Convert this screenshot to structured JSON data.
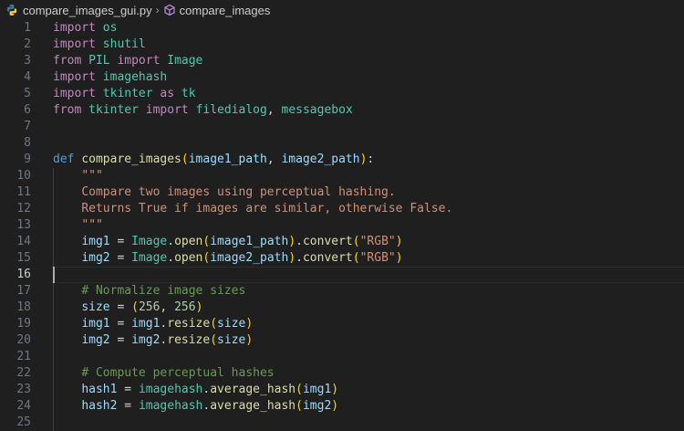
{
  "breadcrumb": {
    "file": "compare_images_gui.py",
    "symbol": "compare_images"
  },
  "current_line": 16,
  "lines": [
    {
      "n": "1",
      "tokens": [
        [
          "kw2",
          "import"
        ],
        [
          "plain",
          " "
        ],
        [
          "mod",
          "os"
        ]
      ]
    },
    {
      "n": "2",
      "tokens": [
        [
          "kw2",
          "import"
        ],
        [
          "plain",
          " "
        ],
        [
          "mod",
          "shutil"
        ]
      ]
    },
    {
      "n": "3",
      "tokens": [
        [
          "kw2",
          "from"
        ],
        [
          "plain",
          " "
        ],
        [
          "mod",
          "PIL"
        ],
        [
          "plain",
          " "
        ],
        [
          "kw2",
          "import"
        ],
        [
          "plain",
          " "
        ],
        [
          "mod",
          "Image"
        ]
      ]
    },
    {
      "n": "4",
      "tokens": [
        [
          "kw2",
          "import"
        ],
        [
          "plain",
          " "
        ],
        [
          "mod",
          "imagehash"
        ]
      ]
    },
    {
      "n": "5",
      "tokens": [
        [
          "kw2",
          "import"
        ],
        [
          "plain",
          " "
        ],
        [
          "mod",
          "tkinter"
        ],
        [
          "plain",
          " "
        ],
        [
          "kw2",
          "as"
        ],
        [
          "plain",
          " "
        ],
        [
          "mod",
          "tk"
        ]
      ]
    },
    {
      "n": "6",
      "tokens": [
        [
          "kw2",
          "from"
        ],
        [
          "plain",
          " "
        ],
        [
          "mod",
          "tkinter"
        ],
        [
          "plain",
          " "
        ],
        [
          "kw2",
          "import"
        ],
        [
          "plain",
          " "
        ],
        [
          "mod",
          "filedialog"
        ],
        [
          "plain",
          ", "
        ],
        [
          "mod",
          "messagebox"
        ]
      ]
    },
    {
      "n": "7",
      "tokens": []
    },
    {
      "n": "8",
      "tokens": []
    },
    {
      "n": "9",
      "tokens": [
        [
          "kw",
          "def"
        ],
        [
          "plain",
          " "
        ],
        [
          "fn",
          "compare_images"
        ],
        [
          "br1",
          "("
        ],
        [
          "var",
          "image1_path"
        ],
        [
          "plain",
          ", "
        ],
        [
          "var",
          "image2_path"
        ],
        [
          "br1",
          ")"
        ],
        [
          "plain",
          ":"
        ]
      ]
    },
    {
      "n": "10",
      "tokens": [
        [
          "plain",
          "    "
        ],
        [
          "str",
          "\"\"\""
        ]
      ]
    },
    {
      "n": "11",
      "tokens": [
        [
          "plain",
          "    "
        ],
        [
          "str",
          "Compare two images using perceptual hashing."
        ]
      ]
    },
    {
      "n": "12",
      "tokens": [
        [
          "plain",
          "    "
        ],
        [
          "str",
          "Returns True if images are similar, otherwise False."
        ]
      ]
    },
    {
      "n": "13",
      "tokens": [
        [
          "plain",
          "    "
        ],
        [
          "str",
          "\"\"\""
        ]
      ]
    },
    {
      "n": "14",
      "tokens": [
        [
          "plain",
          "    "
        ],
        [
          "var",
          "img1"
        ],
        [
          "plain",
          " = "
        ],
        [
          "mod",
          "Image"
        ],
        [
          "plain",
          "."
        ],
        [
          "fn",
          "open"
        ],
        [
          "br1",
          "("
        ],
        [
          "var",
          "image1_path"
        ],
        [
          "br1",
          ")"
        ],
        [
          "plain",
          "."
        ],
        [
          "fn",
          "convert"
        ],
        [
          "br1",
          "("
        ],
        [
          "str",
          "\"RGB\""
        ],
        [
          "br1",
          ")"
        ]
      ]
    },
    {
      "n": "15",
      "tokens": [
        [
          "plain",
          "    "
        ],
        [
          "var",
          "img2"
        ],
        [
          "plain",
          " = "
        ],
        [
          "mod",
          "Image"
        ],
        [
          "plain",
          "."
        ],
        [
          "fn",
          "open"
        ],
        [
          "br1",
          "("
        ],
        [
          "var",
          "image2_path"
        ],
        [
          "br1",
          ")"
        ],
        [
          "plain",
          "."
        ],
        [
          "fn",
          "convert"
        ],
        [
          "br1",
          "("
        ],
        [
          "str",
          "\"RGB\""
        ],
        [
          "br1",
          ")"
        ]
      ]
    },
    {
      "n": "16",
      "tokens": []
    },
    {
      "n": "17",
      "tokens": [
        [
          "plain",
          "    "
        ],
        [
          "com",
          "# Normalize image sizes"
        ]
      ]
    },
    {
      "n": "18",
      "tokens": [
        [
          "plain",
          "    "
        ],
        [
          "var",
          "size"
        ],
        [
          "plain",
          " = "
        ],
        [
          "br1",
          "("
        ],
        [
          "num",
          "256"
        ],
        [
          "plain",
          ", "
        ],
        [
          "num",
          "256"
        ],
        [
          "br1",
          ")"
        ]
      ]
    },
    {
      "n": "19",
      "tokens": [
        [
          "plain",
          "    "
        ],
        [
          "var",
          "img1"
        ],
        [
          "plain",
          " = "
        ],
        [
          "var",
          "img1"
        ],
        [
          "plain",
          "."
        ],
        [
          "fn",
          "resize"
        ],
        [
          "br1",
          "("
        ],
        [
          "var",
          "size"
        ],
        [
          "br1",
          ")"
        ]
      ]
    },
    {
      "n": "20",
      "tokens": [
        [
          "plain",
          "    "
        ],
        [
          "var",
          "img2"
        ],
        [
          "plain",
          " = "
        ],
        [
          "var",
          "img2"
        ],
        [
          "plain",
          "."
        ],
        [
          "fn",
          "resize"
        ],
        [
          "br1",
          "("
        ],
        [
          "var",
          "size"
        ],
        [
          "br1",
          ")"
        ]
      ]
    },
    {
      "n": "21",
      "tokens": []
    },
    {
      "n": "22",
      "tokens": [
        [
          "plain",
          "    "
        ],
        [
          "com",
          "# Compute perceptual hashes"
        ]
      ]
    },
    {
      "n": "23",
      "tokens": [
        [
          "plain",
          "    "
        ],
        [
          "var",
          "hash1"
        ],
        [
          "plain",
          " = "
        ],
        [
          "mod",
          "imagehash"
        ],
        [
          "plain",
          "."
        ],
        [
          "fn",
          "average_hash"
        ],
        [
          "br1",
          "("
        ],
        [
          "var",
          "img1"
        ],
        [
          "br1",
          ")"
        ]
      ]
    },
    {
      "n": "24",
      "tokens": [
        [
          "plain",
          "    "
        ],
        [
          "var",
          "hash2"
        ],
        [
          "plain",
          " = "
        ],
        [
          "mod",
          "imagehash"
        ],
        [
          "plain",
          "."
        ],
        [
          "fn",
          "average_hash"
        ],
        [
          "br1",
          "("
        ],
        [
          "var",
          "img2"
        ],
        [
          "br1",
          ")"
        ]
      ]
    },
    {
      "n": "25",
      "tokens": []
    }
  ]
}
